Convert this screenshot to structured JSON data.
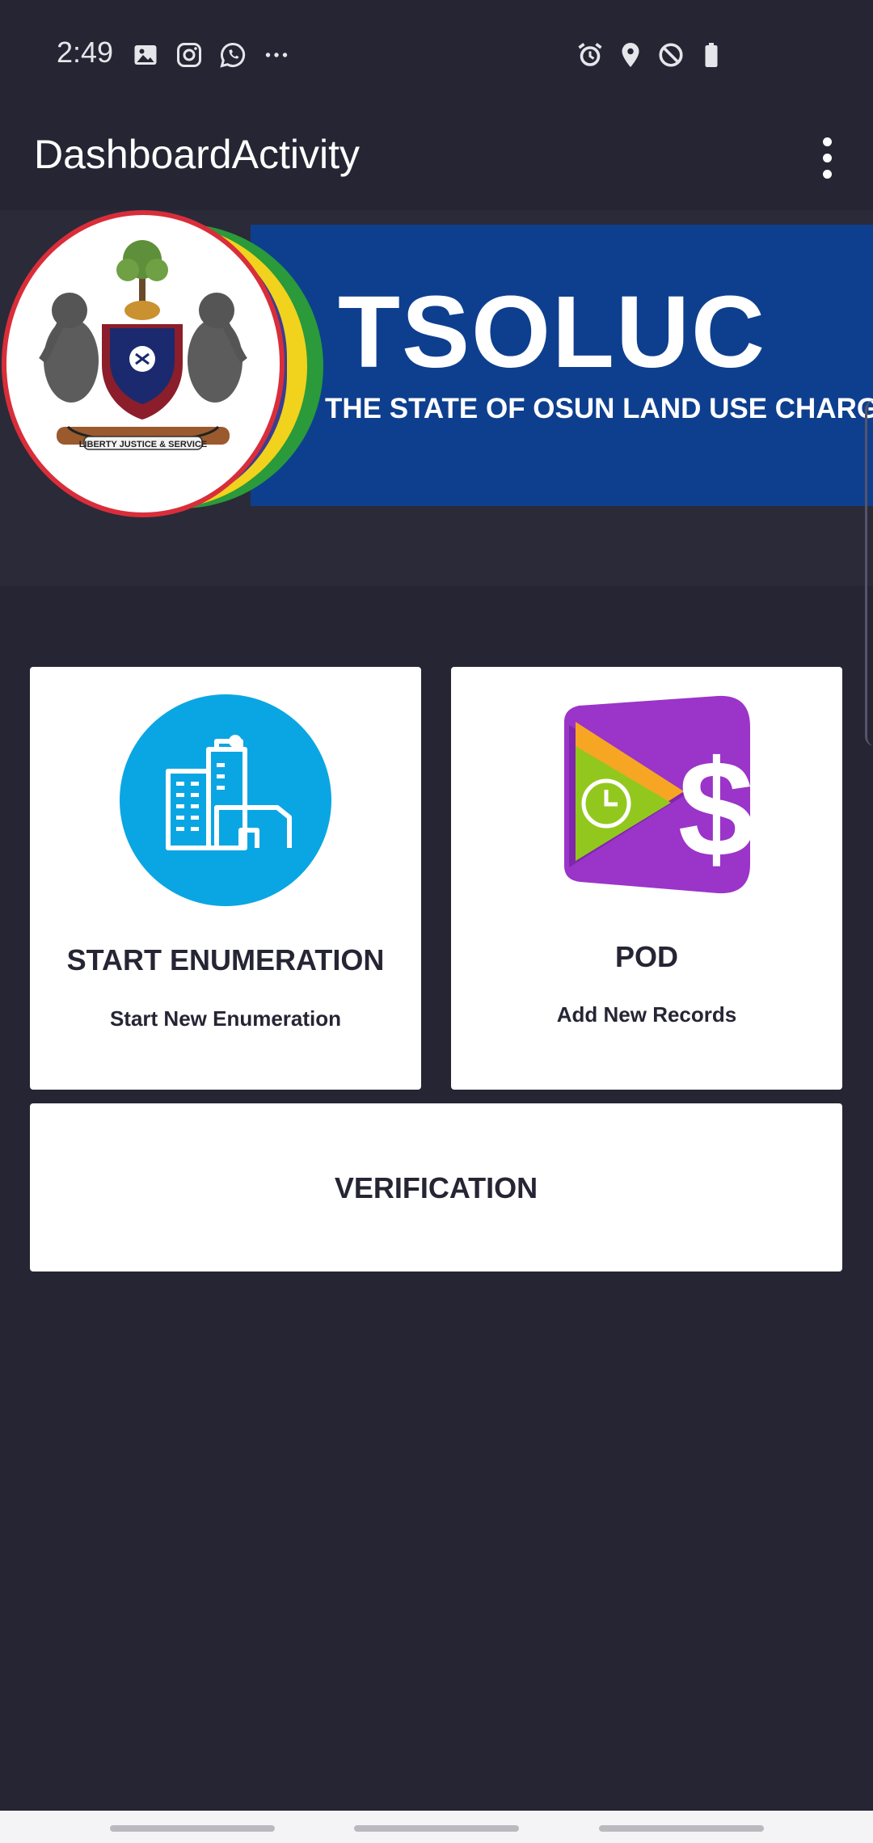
{
  "status_bar": {
    "time": "2:49",
    "left_icons": [
      "gallery-icon",
      "instagram-icon",
      "whatsapp-icon",
      "more-notifications-icon"
    ],
    "right_icons": [
      "alarm-icon",
      "location-icon",
      "do-not-disturb-icon",
      "battery-icon"
    ]
  },
  "app_bar": {
    "title": "DashboardActivity",
    "menu_icon": "overflow-menu-icon"
  },
  "banner": {
    "title": "TSOLUC",
    "subtitle": "THE STATE OF OSUN LAND USE CHARGE",
    "seal_text": "LIBERTY JUSTICE & SERVICE",
    "colors": {
      "blue": "#0e3f8f",
      "red": "#d92e3a",
      "green": "#2a9a3a",
      "yellow": "#f1d21c",
      "purple": "#3b3e91"
    }
  },
  "cards": {
    "enumeration": {
      "title": "START ENUMERATION",
      "subtitle": "Start New Enumeration",
      "icon": "buildings-icon",
      "icon_color": "#0aa6e3"
    },
    "pod": {
      "title": "POD",
      "subtitle": "Add New Records",
      "icon": "pod-payment-icon",
      "icon_color": "#9b34c9"
    },
    "verification": {
      "title": "VERIFICATION"
    }
  },
  "colors": {
    "background": "#262534",
    "card": "#ffffff",
    "text_dark": "#262534"
  }
}
